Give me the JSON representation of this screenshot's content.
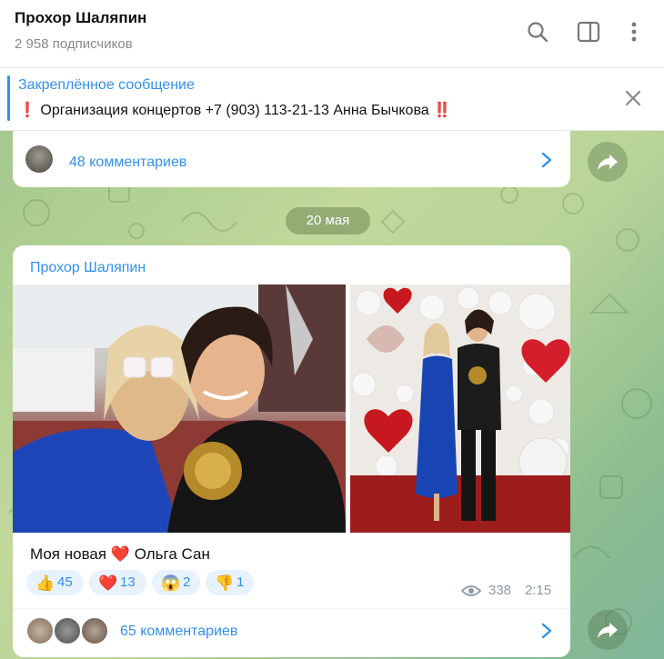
{
  "header": {
    "title": "Прохор Шаляпин",
    "subscribers": "2 958 подписчиков"
  },
  "pinned": {
    "title": "Закреплённое сообщение",
    "text": "❗ Организация концертов +7 (903) 113-21-13 Анна Бычкова ‼️"
  },
  "prev_post": {
    "comments": "48 комментариев"
  },
  "date_separator": "20 мая",
  "post": {
    "author": "Прохор Шаляпин",
    "caption_before": "Моя новая",
    "caption_heart": "❤️",
    "caption_after": "Ольга Сан",
    "reactions": [
      {
        "emoji": "👍",
        "count": "45"
      },
      {
        "emoji": "❤️",
        "count": "13"
      },
      {
        "emoji": "😱",
        "count": "2"
      },
      {
        "emoji": "👎",
        "count": "1"
      }
    ],
    "views": "338",
    "time": "2:15",
    "comments": "65 комментариев"
  },
  "colors": {
    "accent": "#3390ec",
    "chat_bg": "#b9d499"
  },
  "icons": [
    "search-icon",
    "sidebar-toggle-icon",
    "more-vertical-icon",
    "close-icon",
    "chevron-right-icon",
    "share-icon",
    "eye-icon"
  ]
}
